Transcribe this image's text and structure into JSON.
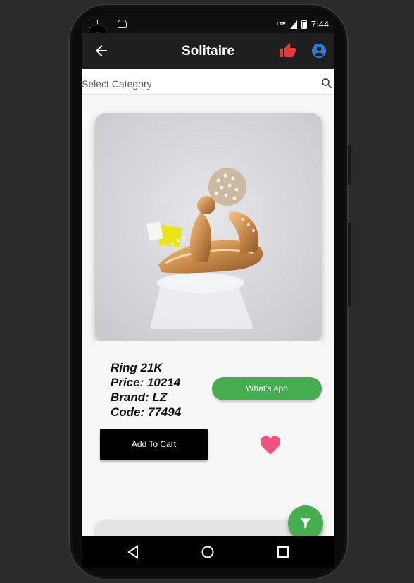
{
  "status_bar": {
    "network": "LTE",
    "time": "7:44",
    "left_icons": [
      "gmail-icon",
      "android-icon"
    ]
  },
  "app_bar": {
    "title": "Solitaire",
    "back_icon": "arrow-back-icon",
    "like_icon": "thumb-up-icon",
    "account_icon": "account-circle-icon"
  },
  "search": {
    "placeholder": "Select Category",
    "icon": "search-icon"
  },
  "product": {
    "name": "Ring 21K",
    "price": "Price: 10214",
    "brand": "Brand: LZ",
    "code": "Code: 77494",
    "whatsapp_label": "What's app",
    "add_to_cart_label": "Add To Cart",
    "favorite_icon": "heart-icon"
  },
  "fab": {
    "icon": "filter-icon"
  },
  "nav": {
    "back": "triangle-back-icon",
    "home": "circle-home-icon",
    "recents": "square-recents-icon"
  },
  "colors": {
    "appbar": "#1f1f1f",
    "whatsapp": "#46ad50",
    "like": "#e53935",
    "account": "#2e7bd6",
    "heart": "#f2527f"
  }
}
